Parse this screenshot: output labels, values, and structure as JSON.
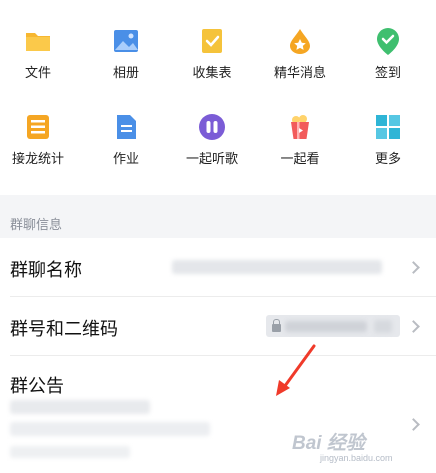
{
  "apps_row1": [
    {
      "label": "文件",
      "icon": "folder-icon"
    },
    {
      "label": "相册",
      "icon": "photo-album-icon"
    },
    {
      "label": "收集表",
      "icon": "collection-form-icon"
    },
    {
      "label": "精华消息",
      "icon": "essence-drop-icon"
    },
    {
      "label": "签到",
      "icon": "check-in-pin-icon"
    }
  ],
  "apps_row2": [
    {
      "label": "接龙统计",
      "icon": "relay-list-icon"
    },
    {
      "label": "作业",
      "icon": "homework-doc-icon"
    },
    {
      "label": "一起听歌",
      "icon": "earbuds-icon"
    },
    {
      "label": "一起看",
      "icon": "popcorn-icon"
    },
    {
      "label": "更多",
      "icon": "more-grid-icon"
    }
  ],
  "section": {
    "title": "群聊信息"
  },
  "rows": {
    "name": {
      "title": "群聊名称"
    },
    "number": {
      "title": "群号和二维码"
    },
    "notice": {
      "title": "群公告"
    }
  },
  "watermark": {
    "brand": "Bai 经验",
    "sub": "jingyan.baidu.com"
  },
  "colors": {
    "folder": "#f7b731",
    "album": "#4a8fe7",
    "form": "#f5c33b",
    "essence": "#f5a623",
    "checkin": "#3fbf6f",
    "relay": "#f5a623",
    "homework": "#4a8fe7",
    "music": "#7b5cd6",
    "popcorn": "#f25b5b",
    "more": "#2fb5d6",
    "arrow": "#f03a2a"
  }
}
